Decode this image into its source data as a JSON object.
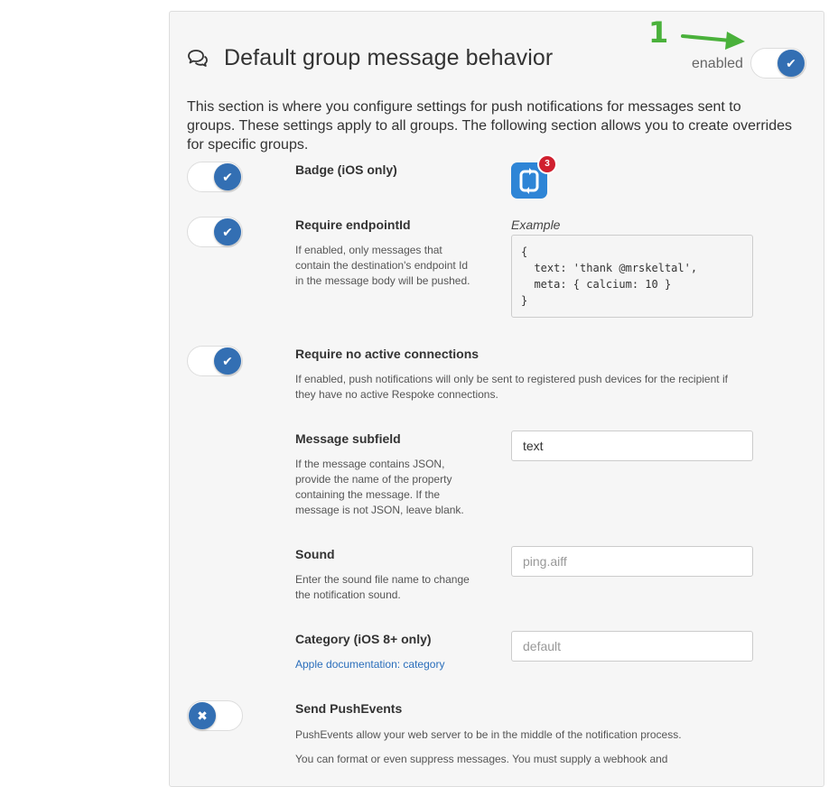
{
  "header": {
    "title": "Default group message behavior",
    "icon": "chat-bubbles-icon",
    "enabled_label": "enabled",
    "annotation_number": "1",
    "annotation_color": "#4ab13b"
  },
  "description": "This section is where you configure settings for push notifications for messages sent to groups. These settings apply to all groups. The following section allows you to create overrides for specific groups.",
  "settings": {
    "badge": {
      "label": "Badge (iOS only)",
      "enabled": true,
      "badge_count": "3"
    },
    "endpoint": {
      "label": "Require endpointId",
      "help": [
        "If enabled, only messages that",
        "contain the destination's endpoint Id",
        "in the message body will be pushed."
      ],
      "enabled": true,
      "example_label": "Example",
      "example_code": "{\n  text: 'thank @mrskeltal',\n  meta: { calcium: 10 }\n}"
    },
    "no_active": {
      "label": "Require no active connections",
      "help": [
        "If enabled, push notifications will only be sent to registered push devices for the recipient if",
        "they have no active Respoke connections."
      ],
      "enabled": true
    },
    "subfield": {
      "label": "Message subfield",
      "help": [
        "If the message contains JSON,",
        "provide the name of the property",
        "containing the message. If the",
        "message is not JSON, leave blank."
      ],
      "value": "text"
    },
    "sound": {
      "label": "Sound",
      "help": [
        "Enter the sound file name to change",
        "the notification sound."
      ],
      "placeholder": "ping.aiff"
    },
    "category": {
      "label": "Category (iOS 8+ only)",
      "link": "Apple documentation: category",
      "placeholder": "default"
    },
    "push_events": {
      "label": "Send PushEvents",
      "help": [
        "PushEvents allow your web server to be in the middle of the notification process.",
        "You can format or even suppress messages. You must supply a webhook and"
      ],
      "enabled": false
    }
  },
  "colors": {
    "accent": "#336fb3",
    "panel_bg": "#f6f6f6",
    "link": "#2a6ebb"
  }
}
